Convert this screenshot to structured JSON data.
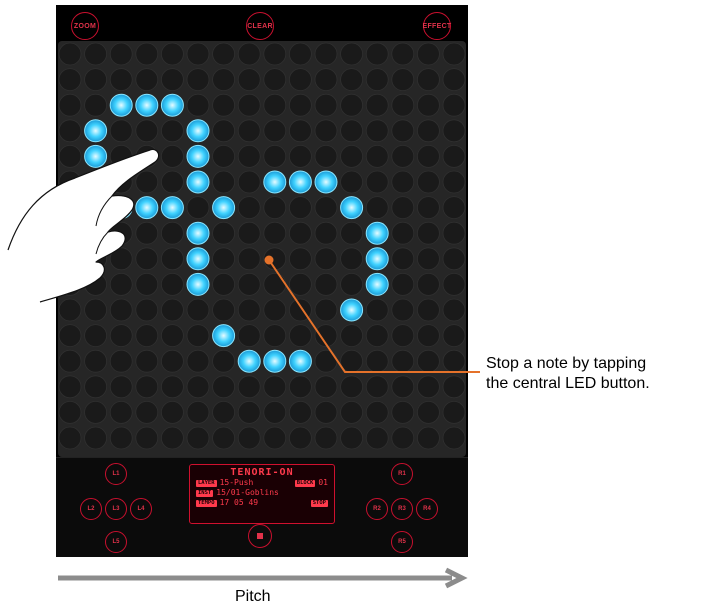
{
  "top_buttons": {
    "zoom": "ZOOM",
    "clear": "CLEAR",
    "effect": "EFFECT"
  },
  "grid": {
    "columns": 16,
    "rows": 16,
    "lit_color": "#3fd2ff",
    "lit_cells": [
      [
        2,
        2
      ],
      [
        3,
        2
      ],
      [
        4,
        2
      ],
      [
        1,
        3
      ],
      [
        5,
        3
      ],
      [
        1,
        4
      ],
      [
        5,
        4
      ],
      [
        1,
        5
      ],
      [
        5,
        5
      ],
      [
        8,
        5
      ],
      [
        9,
        5
      ],
      [
        10,
        5
      ],
      [
        2,
        6
      ],
      [
        3,
        6
      ],
      [
        4,
        6
      ],
      [
        6,
        6
      ],
      [
        11,
        6
      ],
      [
        5,
        7
      ],
      [
        12,
        7
      ],
      [
        5,
        8
      ],
      [
        12,
        8
      ],
      [
        5,
        9
      ],
      [
        12,
        9
      ],
      [
        11,
        10
      ],
      [
        6,
        11
      ],
      [
        7,
        12
      ],
      [
        8,
        12
      ],
      [
        9,
        12
      ]
    ],
    "tapped_cell": [
      8,
      8
    ]
  },
  "console": {
    "left_buttons": [
      "L1",
      "L2",
      "L3",
      "L4",
      "L5"
    ],
    "right_buttons": [
      "R1",
      "R2",
      "R3",
      "R4",
      "R5"
    ],
    "display": {
      "title": "TENORI-ON",
      "rows": [
        {
          "tag": "LAYER",
          "text": "15-Push",
          "tag2": "BLOCK",
          "text2": "01"
        },
        {
          "tag": "INST",
          "text": "15/01-Goblins"
        },
        {
          "tag": "TEMPO",
          "text": "17 05 49",
          "tag2": "STOP"
        }
      ]
    }
  },
  "annotation": {
    "line1": "Stop a note by tapping",
    "line2": "the central LED button.",
    "color": "#e5722a"
  },
  "axis": {
    "label": "Pitch",
    "arrow_color": "#8c8c8c"
  }
}
